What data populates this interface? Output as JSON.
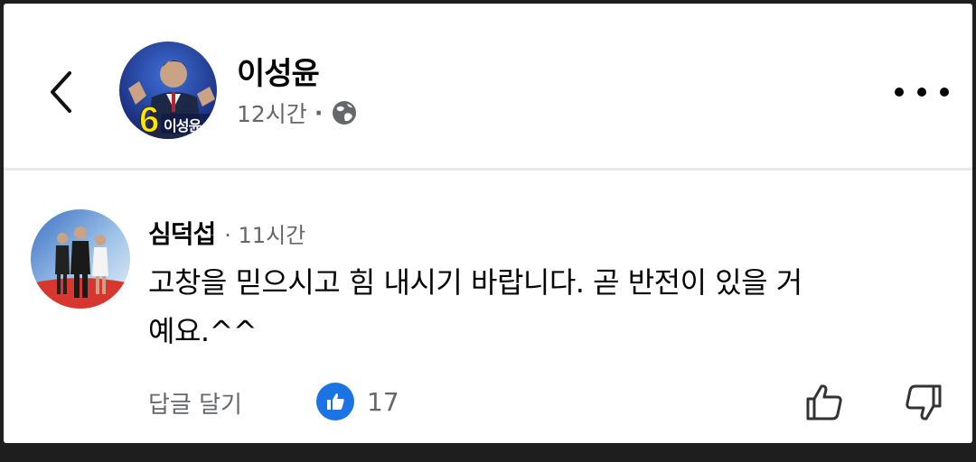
{
  "post": {
    "author": "이성윤",
    "time": "12시간",
    "separator": "·",
    "visibility_icon": "globe-icon",
    "avatar_badge_number": "6",
    "avatar_badge_name": "이성윤"
  },
  "comment": {
    "author": "심덕섭",
    "time": "· 11시간",
    "text_line1": "고창을 믿으시고 힘 내시기 바랍니다. 곧 반전이 있을 거",
    "text_line2": "예요.^^",
    "reply_label": "답글 달기",
    "like_count": "17"
  },
  "icons": {
    "back": "chevron-left-icon",
    "more": "more-dots-icon",
    "like_badge": "like-icon",
    "thumb_up": "thumbs-up-icon",
    "thumb_down": "thumbs-down-icon"
  },
  "colors": {
    "like_blue": "#1b74e4",
    "meta_gray": "#65676b",
    "text": "#050505"
  }
}
